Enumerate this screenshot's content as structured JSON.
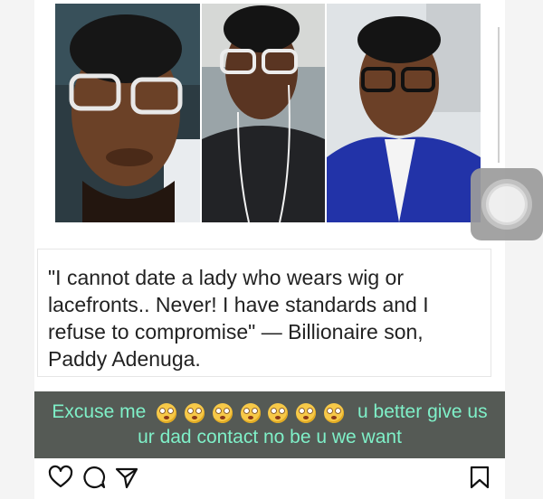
{
  "quote": {
    "text": "\"I cannot date a lady who wears wig or\nlacefronts.. Never! I have standards and I\nrefuse to compromise\" — Billionaire son,\nPaddy Adenuga."
  },
  "caption": {
    "line1_before": "Excuse me",
    "line1_after": "u better give us",
    "line2": "ur dad contact no be u we want",
    "emoji_count": 7,
    "emoji_icon": "rolling-eyes-emoji",
    "text_color": "#7ff0c8",
    "band_color": "#555a55"
  },
  "actions": {
    "icons": [
      "heart-icon",
      "comment-icon",
      "share-icon",
      "bookmark-icon"
    ]
  },
  "overlay": {
    "icon": "assistive-touch-icon"
  }
}
